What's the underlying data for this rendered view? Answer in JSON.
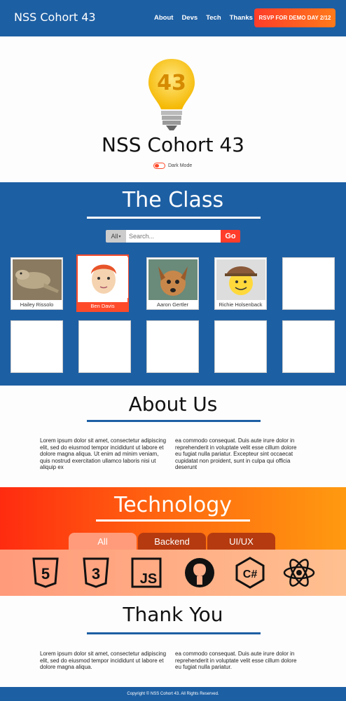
{
  "nav": {
    "brand": "NSS Cohort 43",
    "links": [
      "About",
      "Devs",
      "Tech",
      "Thanks"
    ],
    "rsvp": "RSVP FOR DEMO DAY 2/12"
  },
  "hero": {
    "logo_text": "43",
    "title": "NSS Cohort 43",
    "dark_mode_label": "Dark Mode"
  },
  "class": {
    "title": "The Class",
    "search": {
      "filter": "All",
      "placeholder": "Search...",
      "go": "Go"
    },
    "members": [
      "Hailey Rissolo",
      "Ben Davis",
      "Aaron Gertler",
      "Richie Holsenback",
      "",
      "",
      "",
      "",
      "",
      ""
    ]
  },
  "about": {
    "title": "About Us",
    "col1": "Lorem ipsum dolor sit amet, consectetur adipiscing elit, sed do eiusmod tempor incididunt ut labore et dolore magna aliqua. Ut enim ad minim veniam, quis nostrud exercitation ullamco laboris nisi ut aliquip ex",
    "col2": "ea commodo consequat. Duis aute irure dolor in reprehenderit in voluptate velit esse cillum dolore eu fugiat nulla pariatur. Excepteur sint occaecat cupidatat non proident, sunt in culpa qui officia deserunt"
  },
  "technology": {
    "title": "Technology",
    "tabs": [
      "All",
      "Backend",
      "UI/UX"
    ],
    "icons": [
      "html5-icon",
      "css3-icon",
      "js-icon",
      "github-icon",
      "csharp-icon",
      "react-icon"
    ],
    "icon_labels": {
      "html": "5",
      "css": "3",
      "js": "JS",
      "csharp": "C#"
    }
  },
  "thanks": {
    "title": "Thank You",
    "col1": "Lorem ipsum dolor sit amet, consectetur adipiscing elit, sed do eiusmod tempor incididunt ut labore et dolore magna aliqua.",
    "col2": "ea commodo consequat. Duis aute irure dolor in reprehenderit in voluptate velit esse cillum dolore eu fugiat nulla pariatur."
  },
  "footer": {
    "text": "Copyright © NSS Cohort 43. All Rights Reserved."
  },
  "colors": {
    "primary": "#1d5fa3",
    "accent": "#ff3d2a"
  }
}
